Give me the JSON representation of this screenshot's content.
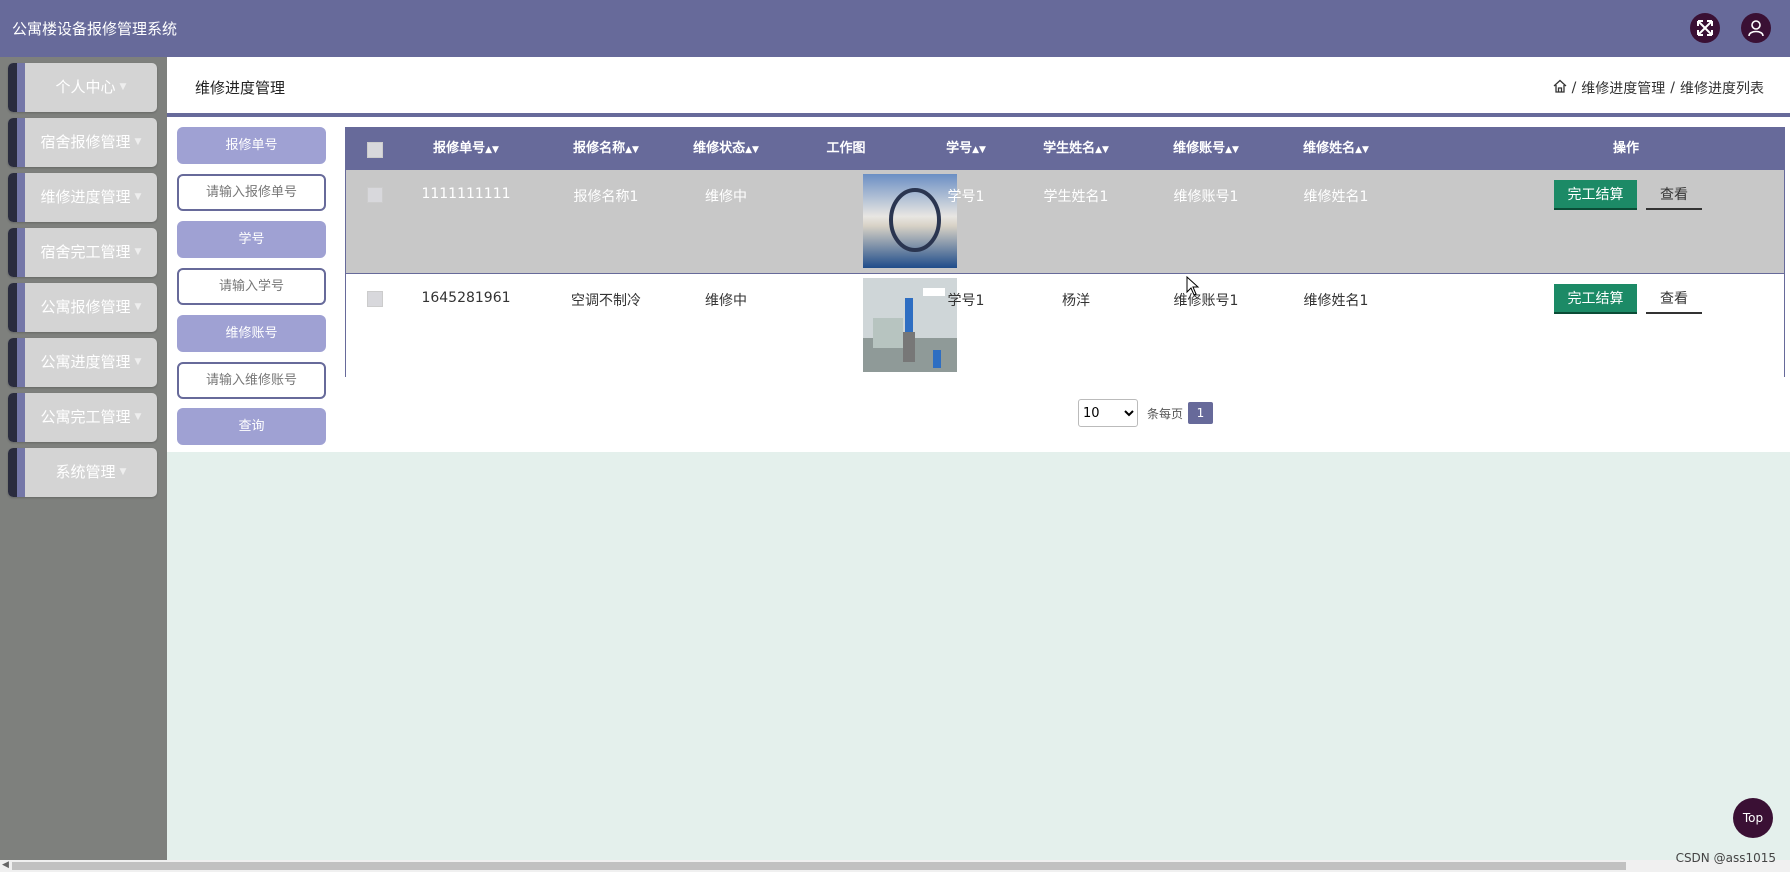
{
  "app": {
    "title": "公寓楼设备报修管理系统"
  },
  "header_icons": {
    "fullscreen": "fullscreen-icon",
    "user": "user-icon"
  },
  "sidebar": {
    "items": [
      {
        "label": "个人中心"
      },
      {
        "label": "宿舍报修管理"
      },
      {
        "label": "维修进度管理"
      },
      {
        "label": "宿舍完工管理"
      },
      {
        "label": "公寓报修管理"
      },
      {
        "label": "公寓进度管理"
      },
      {
        "label": "公寓完工管理"
      },
      {
        "label": "系统管理"
      }
    ]
  },
  "page": {
    "title": "维修进度管理",
    "breadcrumb": {
      "home_icon": "home-icon",
      "items": [
        "维修进度管理",
        "维修进度列表"
      ],
      "separator": "/"
    }
  },
  "filters": {
    "order_no_label": "报修单号",
    "order_no_placeholder": "请输入报修单号",
    "student_no_label": "学号",
    "student_no_placeholder": "请输入学号",
    "repair_account_label": "维修账号",
    "repair_account_placeholder": "请输入维修账号",
    "query_button": "查询"
  },
  "table": {
    "headers": [
      "报修单号",
      "报修名称",
      "维修状态",
      "工作图",
      "学号",
      "学生姓名",
      "维修账号",
      "维修姓名",
      "操作"
    ],
    "rows": [
      {
        "order_no": "1111111111",
        "name": "报修名称1",
        "status": "维修中",
        "student_no": "学号1",
        "student_name": "学生姓名1",
        "repair_account": "维修账号1",
        "repair_name": "维修姓名1",
        "finish": "完工结算",
        "view": "查看"
      },
      {
        "order_no": "1645281961",
        "name": "空调不制冷",
        "status": "维修中",
        "student_no": "学号1",
        "student_name": "杨洋",
        "repair_account": "维修账号1",
        "repair_name": "维修姓名1",
        "finish": "完工结算",
        "view": "查看"
      }
    ]
  },
  "pagination": {
    "page_size": "10",
    "per_page_label": "条每页",
    "current_page": "1"
  },
  "misc": {
    "top_button": "Top",
    "watermark": "CSDN @ass1015"
  },
  "colors": {
    "primary": "#676a9a",
    "success": "#1c8a66",
    "dark_accent": "#3a1034"
  }
}
